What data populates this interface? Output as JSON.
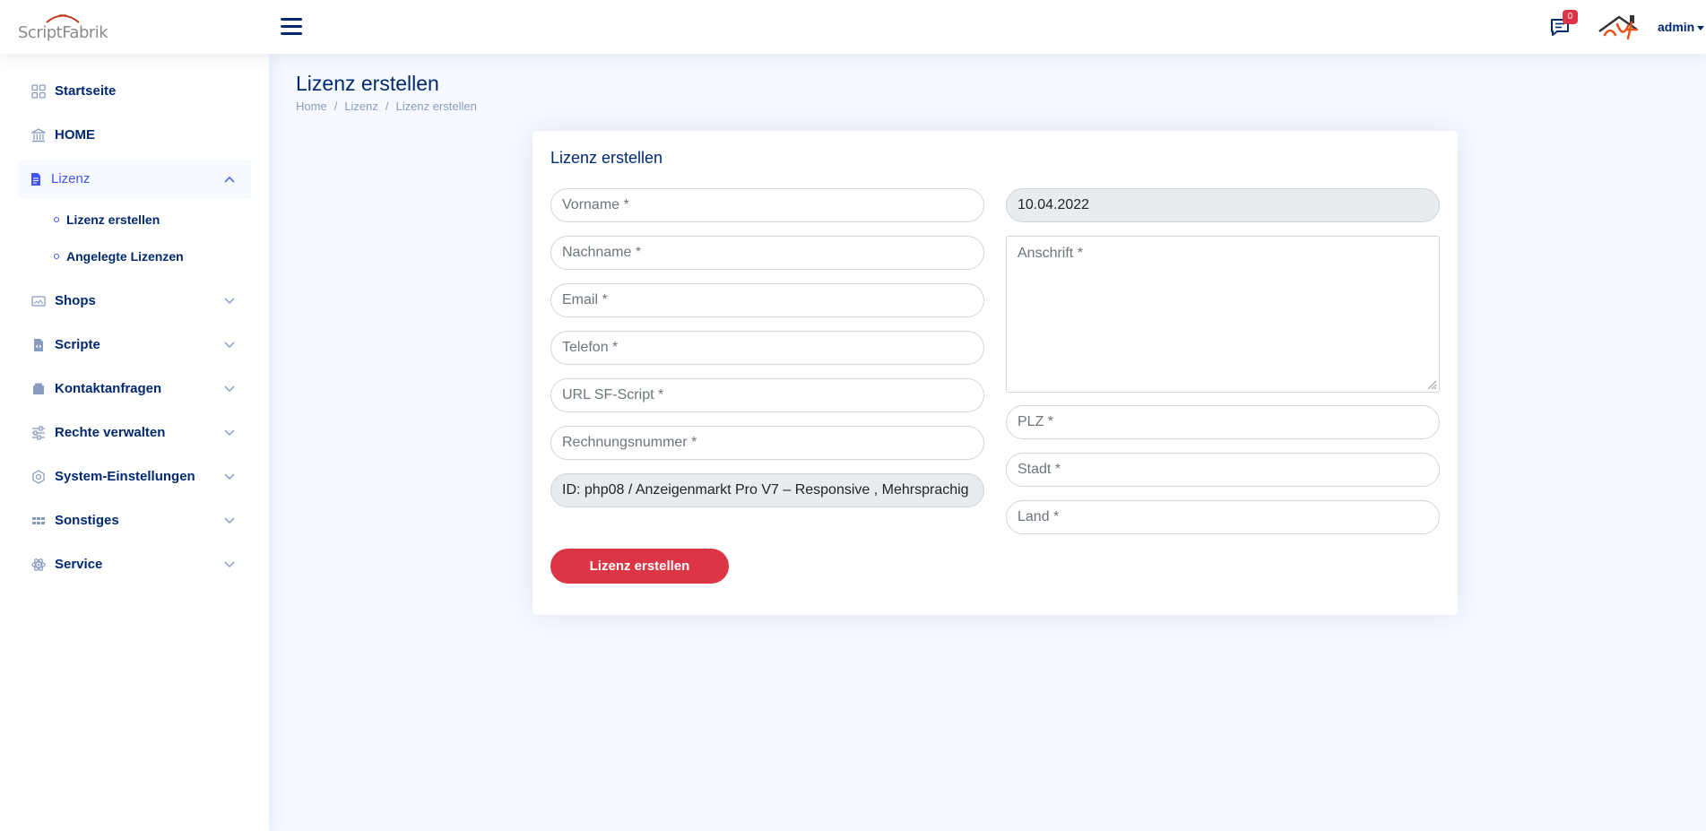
{
  "header": {
    "logo_text": "ScriptFabrik",
    "notification_count": "0",
    "user_name": "admin"
  },
  "sidebar": {
    "items": [
      {
        "label": "Startseite",
        "icon": "grid-icon"
      },
      {
        "label": "HOME",
        "icon": "bank-icon"
      },
      {
        "label": "Lizenz",
        "icon": "document-icon",
        "expanded": true
      },
      {
        "label": "Shops",
        "icon": "card-image-icon"
      },
      {
        "label": "Scripte",
        "icon": "file-code-icon"
      },
      {
        "label": "Kontaktanfragen",
        "icon": "inbox-icon"
      },
      {
        "label": "Rechte verwalten",
        "icon": "sliders-icon"
      },
      {
        "label": "System-Einstellungen",
        "icon": "gear-icon"
      },
      {
        "label": "Sonstiges",
        "icon": "apps-icon"
      },
      {
        "label": "Service",
        "icon": "atom-icon"
      }
    ],
    "subitems": [
      "Lizenz erstellen",
      "Angelegte Lizenzen"
    ]
  },
  "page": {
    "title": "Lizenz erstellen",
    "breadcrumb": [
      "Home",
      "Lizenz",
      "Lizenz erstellen"
    ]
  },
  "form": {
    "title": "Lizenz erstellen",
    "vorname_placeholder": "Vorname *",
    "nachname_placeholder": "Nachname *",
    "email_placeholder": "Email  *",
    "telefon_placeholder": "Telefon  *",
    "url_placeholder": "URL SF-Script *",
    "rechnung_placeholder": "Rechnungsnummer *",
    "script_select_value": "ID: php08  /  Anzeigenmarkt Pro V7 – Responsive , Mehrsprachig",
    "date_value": "10.04.2022",
    "anschrift_placeholder": "Anschrift *",
    "plz_placeholder": "PLZ  *",
    "stadt_placeholder": "Stadt  *",
    "land_placeholder": "Land  *",
    "submit_label": "Lizenz erstellen"
  },
  "colors": {
    "primary": "#4154f1",
    "navy": "#012970",
    "danger": "#dc3545",
    "background": "#f6f9ff"
  }
}
